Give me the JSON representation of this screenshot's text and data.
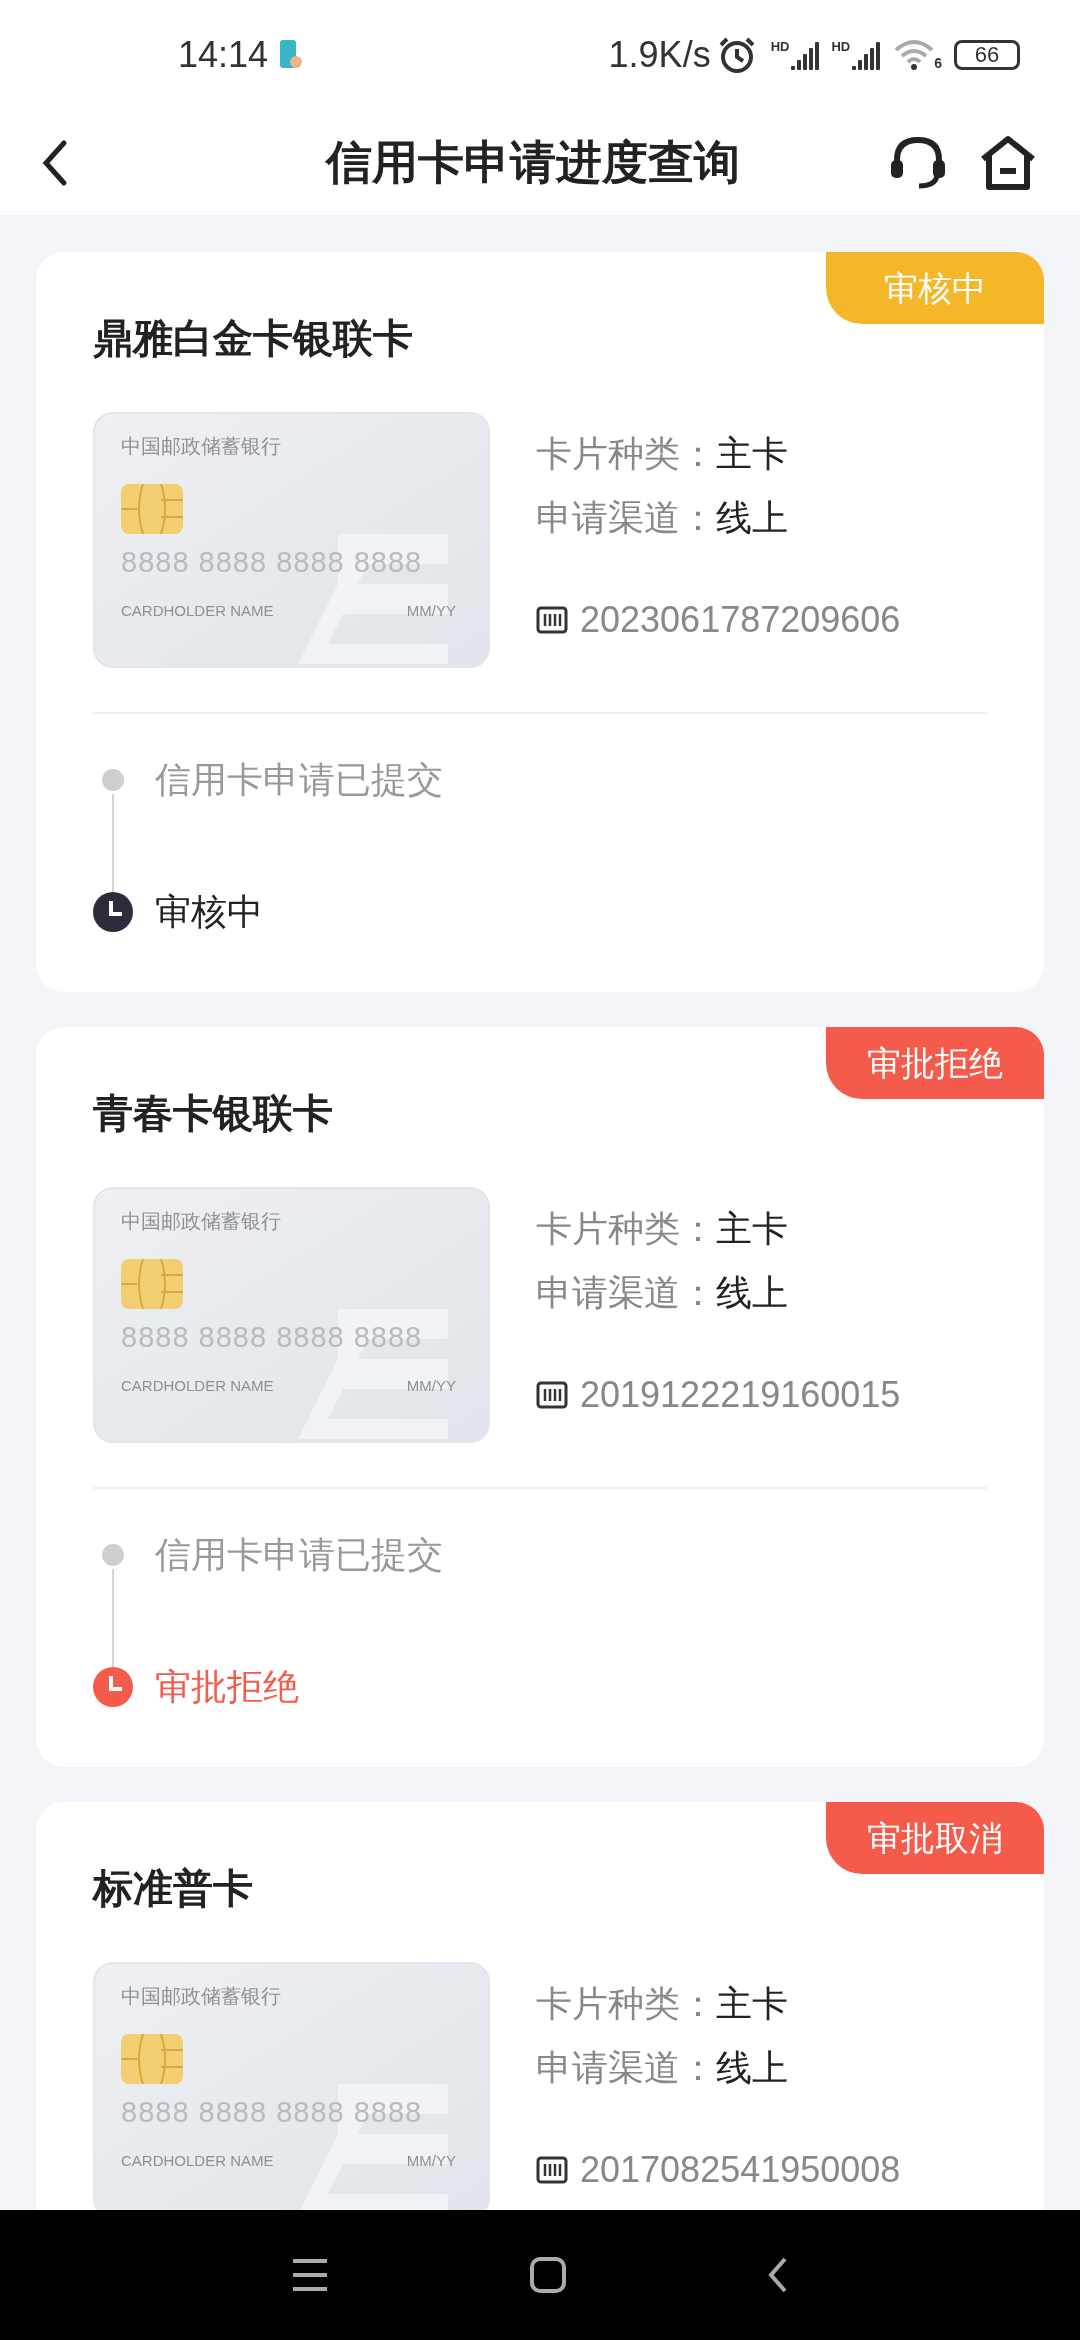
{
  "status_bar": {
    "time": "14:14",
    "speed": "1.9K/s",
    "signal_labels": [
      "HD",
      "HD"
    ],
    "wifi_badge": "6",
    "battery": "66"
  },
  "header": {
    "title": "信用卡申请进度查询"
  },
  "applications": [
    {
      "title": "鼎雅白金卡银联卡",
      "badge": {
        "text": "审核中",
        "color": "#f4b72a"
      },
      "card_image": {
        "bank": "中国邮政储蓄银行",
        "number": "8888 8888 8888 8888",
        "holder": "CARDHOLDER NAME",
        "expiry": "MM/YY"
      },
      "fields": [
        {
          "label": "卡片种类：",
          "value": "主卡"
        },
        {
          "label": "申请渠道：",
          "value": "线上"
        }
      ],
      "application_no": "2023061787209606",
      "steps": [
        {
          "kind": "done",
          "text": "信用卡申请已提交"
        },
        {
          "kind": "current",
          "text": "审核中",
          "color": "#2c2c3a"
        }
      ]
    },
    {
      "title": "青春卡银联卡",
      "badge": {
        "text": "审批拒绝",
        "color": "#f45b4b"
      },
      "card_image": {
        "bank": "中国邮政储蓄银行",
        "number": "8888 8888 8888 8888",
        "holder": "CARDHOLDER NAME",
        "expiry": "MM/YY"
      },
      "fields": [
        {
          "label": "卡片种类：",
          "value": "主卡"
        },
        {
          "label": "申请渠道：",
          "value": "线上"
        }
      ],
      "application_no": "2019122219160015",
      "steps": [
        {
          "kind": "done",
          "text": "信用卡申请已提交"
        },
        {
          "kind": "current",
          "text": "审批拒绝",
          "color": "#f45b4b"
        }
      ]
    },
    {
      "title": "标准普卡",
      "badge": {
        "text": "审批取消",
        "color": "#f45b4b"
      },
      "card_image": {
        "bank": "中国邮政储蓄银行",
        "number": "8888 8888 8888 8888",
        "holder": "CARDHOLDER NAME",
        "expiry": "MM/YY"
      },
      "fields": [
        {
          "label": "卡片种类：",
          "value": "主卡"
        },
        {
          "label": "申请渠道：",
          "value": "线上"
        }
      ],
      "application_no": "2017082541950008"
    }
  ]
}
